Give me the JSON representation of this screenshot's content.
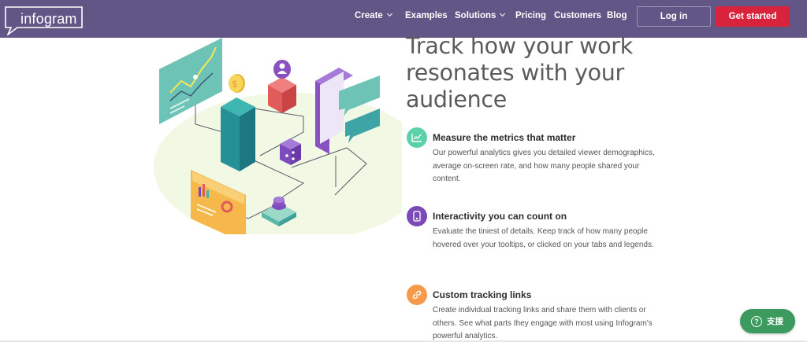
{
  "nav": {
    "logo": "infogram",
    "links": [
      {
        "label": "Create",
        "dropdown": true
      },
      {
        "label": "Examples",
        "dropdown": false
      },
      {
        "label": "Solutions",
        "dropdown": true
      },
      {
        "label": "Pricing",
        "dropdown": false
      },
      {
        "label": "Customers",
        "dropdown": false
      },
      {
        "label": "Blog",
        "dropdown": false
      }
    ],
    "login_label": "Log in",
    "get_started_label": "Get started"
  },
  "hero": {
    "headline_lines": [
      "Track how your work",
      "resonates with your",
      "audience"
    ]
  },
  "features": [
    {
      "icon": "chart-line-icon",
      "icon_color": "#5cd0a8",
      "title": "Measure the metrics that matter",
      "description": "Our powerful analytics gives you detailed viewer demographics, average on-screen rate, and how many people shared your content."
    },
    {
      "icon": "touch-icon",
      "icon_color": "#7a4bb7",
      "title": "Interactivity you can count on",
      "description": "Evaluate the tiniest of details. Keep track of how many people hovered over your tooltips, or clicked on your tabs and legends."
    },
    {
      "icon": "link-icon",
      "icon_color": "#f59a4b",
      "title": "Custom tracking links",
      "description": "Create individual tracking links and share them with clients or others. See what parts they engage with most using Infogram's powerful analytics."
    }
  ],
  "support": {
    "icon": "question-icon",
    "label": "支援"
  },
  "colors": {
    "nav_bg": "#625686",
    "accent_red": "#d9223c",
    "support_green": "#3c9a5f"
  }
}
